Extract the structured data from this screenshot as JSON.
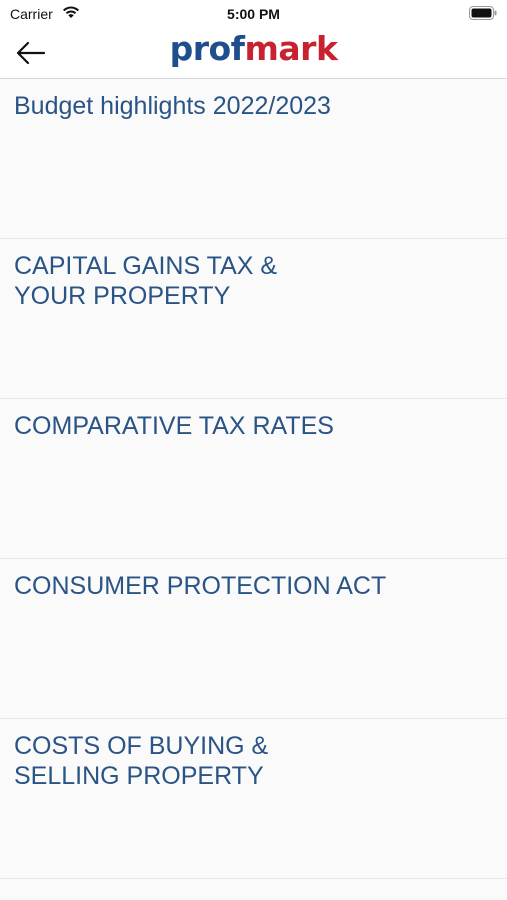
{
  "status_bar": {
    "carrier": "Carrier",
    "time": "5:00 PM",
    "icons": [
      "wifi-icon",
      "battery-icon"
    ]
  },
  "nav": {
    "back_icon": "arrow-left-icon",
    "logo_part1": "prof",
    "logo_part2": "mark",
    "colors": {
      "logo_blue": "#1f4e8c",
      "logo_red": "#c8212f"
    }
  },
  "list": {
    "text_color": "#2a5485",
    "items": [
      {
        "label": "Budget highlights 2022/2023"
      },
      {
        "label": "CAPITAL GAINS TAX &\nYOUR PROPERTY"
      },
      {
        "label": "COMPARATIVE TAX RATES"
      },
      {
        "label": "CONSUMER PROTECTION ACT"
      },
      {
        "label": "COSTS OF BUYING &\nSELLING PROPERTY"
      }
    ]
  }
}
